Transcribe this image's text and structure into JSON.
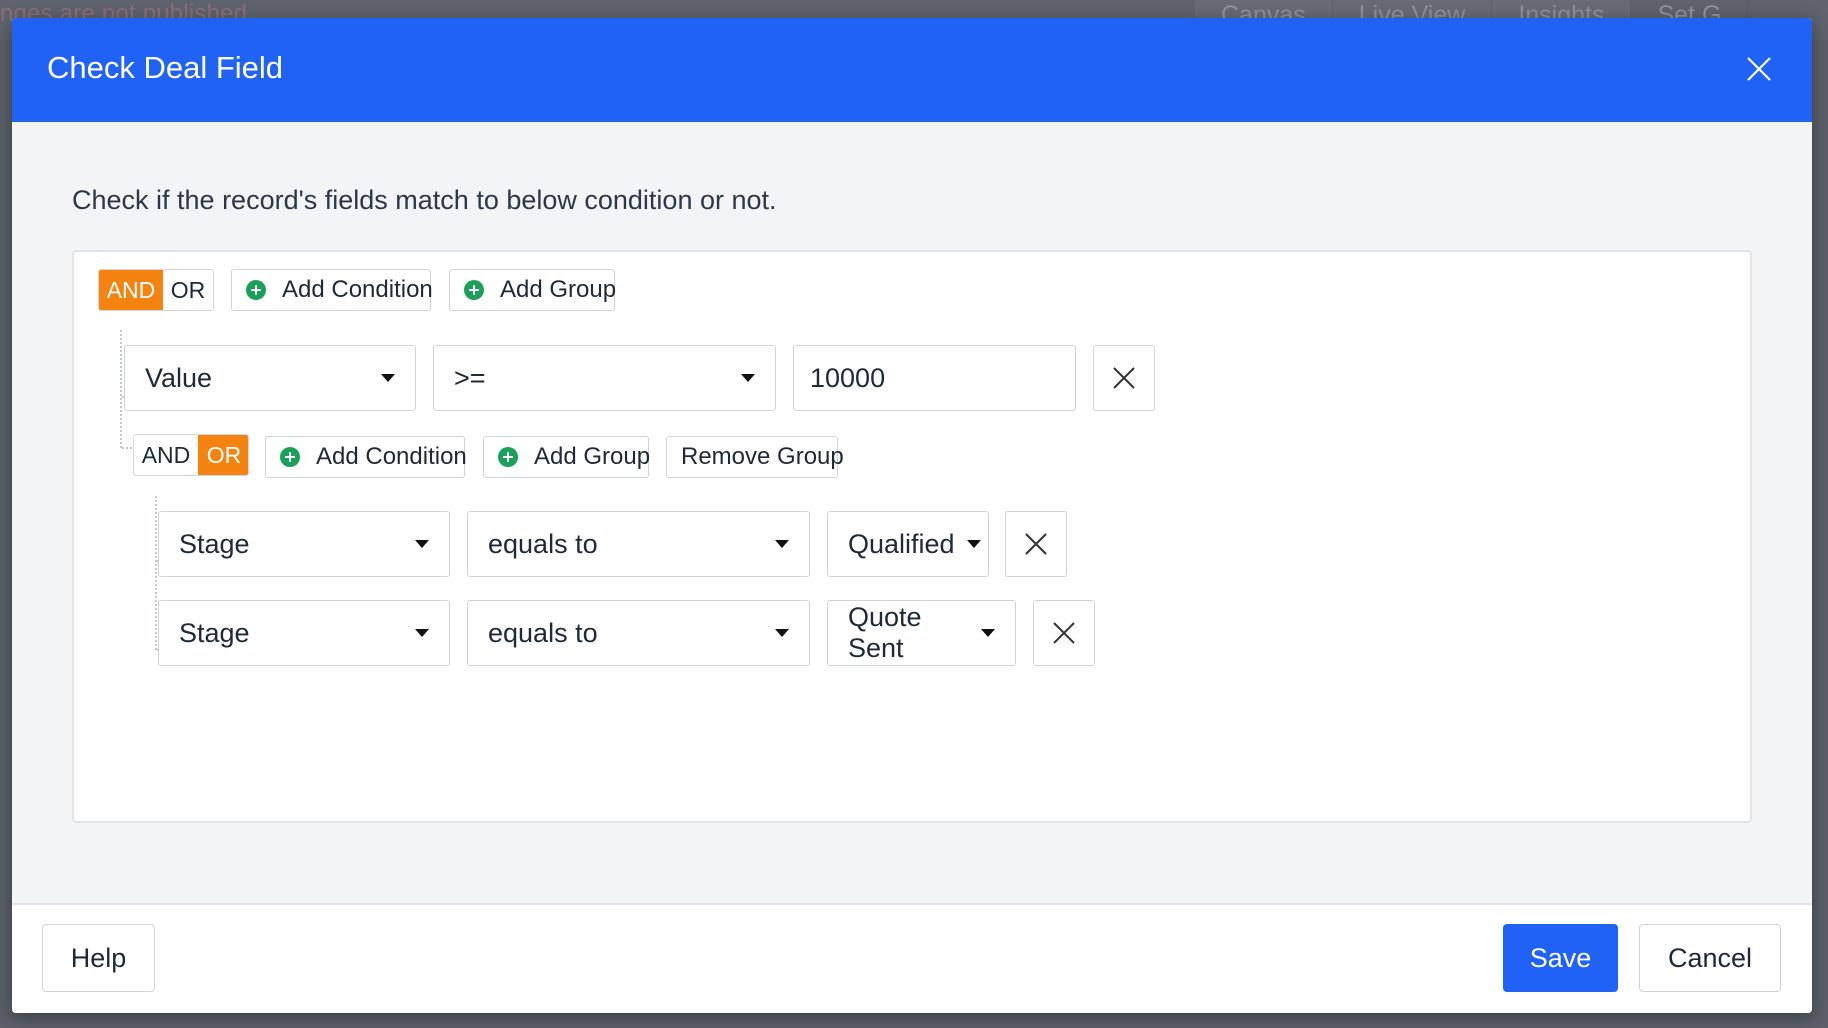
{
  "background": {
    "unpublished_text": "nges are not published",
    "tabs": [
      "Canvas",
      "Live View",
      "Insights",
      "Set G"
    ]
  },
  "modal": {
    "title": "Check Deal Field",
    "description": "Check if the record's fields match to below condition or not."
  },
  "root_group": {
    "logic": {
      "and_label": "AND",
      "or_label": "OR",
      "active": "AND"
    },
    "add_condition_label": "Add Condition",
    "add_group_label": "Add Group",
    "condition": {
      "field": "Value",
      "operator": ">=",
      "value": "10000"
    }
  },
  "sub_group": {
    "logic": {
      "and_label": "AND",
      "or_label": "OR",
      "active": "OR"
    },
    "add_condition_label": "Add Condition",
    "add_group_label": "Add Group",
    "remove_group_label": "Remove Group",
    "conditions": [
      {
        "field": "Stage",
        "operator": "equals to",
        "value": "Qualified"
      },
      {
        "field": "Stage",
        "operator": "equals to",
        "value": "Quote Sent"
      }
    ]
  },
  "footer": {
    "help_label": "Help",
    "save_label": "Save",
    "cancel_label": "Cancel"
  },
  "colors": {
    "header_blue": "#1f62f5",
    "active_logic_orange": "#f5830f",
    "plus_green": "#19a15a"
  }
}
